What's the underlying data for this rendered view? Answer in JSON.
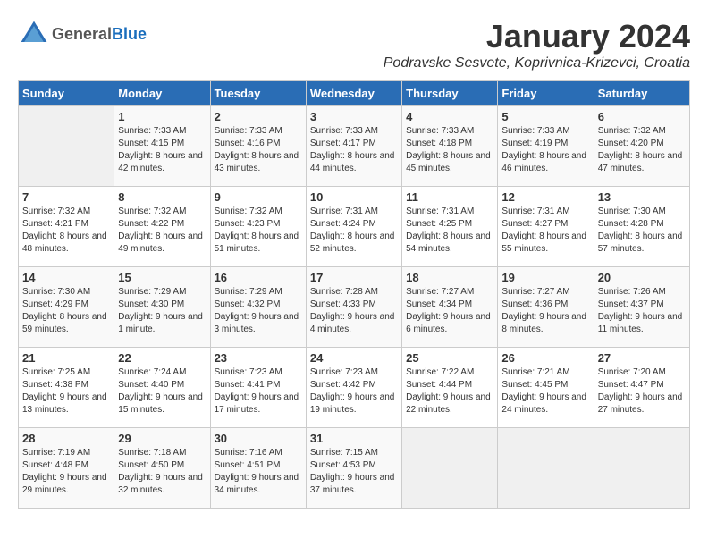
{
  "header": {
    "logo": {
      "text_general": "General",
      "text_blue": "Blue"
    },
    "title": "January 2024",
    "location": "Podravske Sesvete, Koprivnica-Krizevci, Croatia"
  },
  "days_of_week": [
    "Sunday",
    "Monday",
    "Tuesday",
    "Wednesday",
    "Thursday",
    "Friday",
    "Saturday"
  ],
  "weeks": [
    [
      {
        "day": "",
        "sunrise": "",
        "sunset": "",
        "daylight": ""
      },
      {
        "day": "1",
        "sunrise": "Sunrise: 7:33 AM",
        "sunset": "Sunset: 4:15 PM",
        "daylight": "Daylight: 8 hours and 42 minutes."
      },
      {
        "day": "2",
        "sunrise": "Sunrise: 7:33 AM",
        "sunset": "Sunset: 4:16 PM",
        "daylight": "Daylight: 8 hours and 43 minutes."
      },
      {
        "day": "3",
        "sunrise": "Sunrise: 7:33 AM",
        "sunset": "Sunset: 4:17 PM",
        "daylight": "Daylight: 8 hours and 44 minutes."
      },
      {
        "day": "4",
        "sunrise": "Sunrise: 7:33 AM",
        "sunset": "Sunset: 4:18 PM",
        "daylight": "Daylight: 8 hours and 45 minutes."
      },
      {
        "day": "5",
        "sunrise": "Sunrise: 7:33 AM",
        "sunset": "Sunset: 4:19 PM",
        "daylight": "Daylight: 8 hours and 46 minutes."
      },
      {
        "day": "6",
        "sunrise": "Sunrise: 7:32 AM",
        "sunset": "Sunset: 4:20 PM",
        "daylight": "Daylight: 8 hours and 47 minutes."
      }
    ],
    [
      {
        "day": "7",
        "sunrise": "Sunrise: 7:32 AM",
        "sunset": "Sunset: 4:21 PM",
        "daylight": "Daylight: 8 hours and 48 minutes."
      },
      {
        "day": "8",
        "sunrise": "Sunrise: 7:32 AM",
        "sunset": "Sunset: 4:22 PM",
        "daylight": "Daylight: 8 hours and 49 minutes."
      },
      {
        "day": "9",
        "sunrise": "Sunrise: 7:32 AM",
        "sunset": "Sunset: 4:23 PM",
        "daylight": "Daylight: 8 hours and 51 minutes."
      },
      {
        "day": "10",
        "sunrise": "Sunrise: 7:31 AM",
        "sunset": "Sunset: 4:24 PM",
        "daylight": "Daylight: 8 hours and 52 minutes."
      },
      {
        "day": "11",
        "sunrise": "Sunrise: 7:31 AM",
        "sunset": "Sunset: 4:25 PM",
        "daylight": "Daylight: 8 hours and 54 minutes."
      },
      {
        "day": "12",
        "sunrise": "Sunrise: 7:31 AM",
        "sunset": "Sunset: 4:27 PM",
        "daylight": "Daylight: 8 hours and 55 minutes."
      },
      {
        "day": "13",
        "sunrise": "Sunrise: 7:30 AM",
        "sunset": "Sunset: 4:28 PM",
        "daylight": "Daylight: 8 hours and 57 minutes."
      }
    ],
    [
      {
        "day": "14",
        "sunrise": "Sunrise: 7:30 AM",
        "sunset": "Sunset: 4:29 PM",
        "daylight": "Daylight: 8 hours and 59 minutes."
      },
      {
        "day": "15",
        "sunrise": "Sunrise: 7:29 AM",
        "sunset": "Sunset: 4:30 PM",
        "daylight": "Daylight: 9 hours and 1 minute."
      },
      {
        "day": "16",
        "sunrise": "Sunrise: 7:29 AM",
        "sunset": "Sunset: 4:32 PM",
        "daylight": "Daylight: 9 hours and 3 minutes."
      },
      {
        "day": "17",
        "sunrise": "Sunrise: 7:28 AM",
        "sunset": "Sunset: 4:33 PM",
        "daylight": "Daylight: 9 hours and 4 minutes."
      },
      {
        "day": "18",
        "sunrise": "Sunrise: 7:27 AM",
        "sunset": "Sunset: 4:34 PM",
        "daylight": "Daylight: 9 hours and 6 minutes."
      },
      {
        "day": "19",
        "sunrise": "Sunrise: 7:27 AM",
        "sunset": "Sunset: 4:36 PM",
        "daylight": "Daylight: 9 hours and 8 minutes."
      },
      {
        "day": "20",
        "sunrise": "Sunrise: 7:26 AM",
        "sunset": "Sunset: 4:37 PM",
        "daylight": "Daylight: 9 hours and 11 minutes."
      }
    ],
    [
      {
        "day": "21",
        "sunrise": "Sunrise: 7:25 AM",
        "sunset": "Sunset: 4:38 PM",
        "daylight": "Daylight: 9 hours and 13 minutes."
      },
      {
        "day": "22",
        "sunrise": "Sunrise: 7:24 AM",
        "sunset": "Sunset: 4:40 PM",
        "daylight": "Daylight: 9 hours and 15 minutes."
      },
      {
        "day": "23",
        "sunrise": "Sunrise: 7:23 AM",
        "sunset": "Sunset: 4:41 PM",
        "daylight": "Daylight: 9 hours and 17 minutes."
      },
      {
        "day": "24",
        "sunrise": "Sunrise: 7:23 AM",
        "sunset": "Sunset: 4:42 PM",
        "daylight": "Daylight: 9 hours and 19 minutes."
      },
      {
        "day": "25",
        "sunrise": "Sunrise: 7:22 AM",
        "sunset": "Sunset: 4:44 PM",
        "daylight": "Daylight: 9 hours and 22 minutes."
      },
      {
        "day": "26",
        "sunrise": "Sunrise: 7:21 AM",
        "sunset": "Sunset: 4:45 PM",
        "daylight": "Daylight: 9 hours and 24 minutes."
      },
      {
        "day": "27",
        "sunrise": "Sunrise: 7:20 AM",
        "sunset": "Sunset: 4:47 PM",
        "daylight": "Daylight: 9 hours and 27 minutes."
      }
    ],
    [
      {
        "day": "28",
        "sunrise": "Sunrise: 7:19 AM",
        "sunset": "Sunset: 4:48 PM",
        "daylight": "Daylight: 9 hours and 29 minutes."
      },
      {
        "day": "29",
        "sunrise": "Sunrise: 7:18 AM",
        "sunset": "Sunset: 4:50 PM",
        "daylight": "Daylight: 9 hours and 32 minutes."
      },
      {
        "day": "30",
        "sunrise": "Sunrise: 7:16 AM",
        "sunset": "Sunset: 4:51 PM",
        "daylight": "Daylight: 9 hours and 34 minutes."
      },
      {
        "day": "31",
        "sunrise": "Sunrise: 7:15 AM",
        "sunset": "Sunset: 4:53 PM",
        "daylight": "Daylight: 9 hours and 37 minutes."
      },
      {
        "day": "",
        "sunrise": "",
        "sunset": "",
        "daylight": ""
      },
      {
        "day": "",
        "sunrise": "",
        "sunset": "",
        "daylight": ""
      },
      {
        "day": "",
        "sunrise": "",
        "sunset": "",
        "daylight": ""
      }
    ]
  ]
}
